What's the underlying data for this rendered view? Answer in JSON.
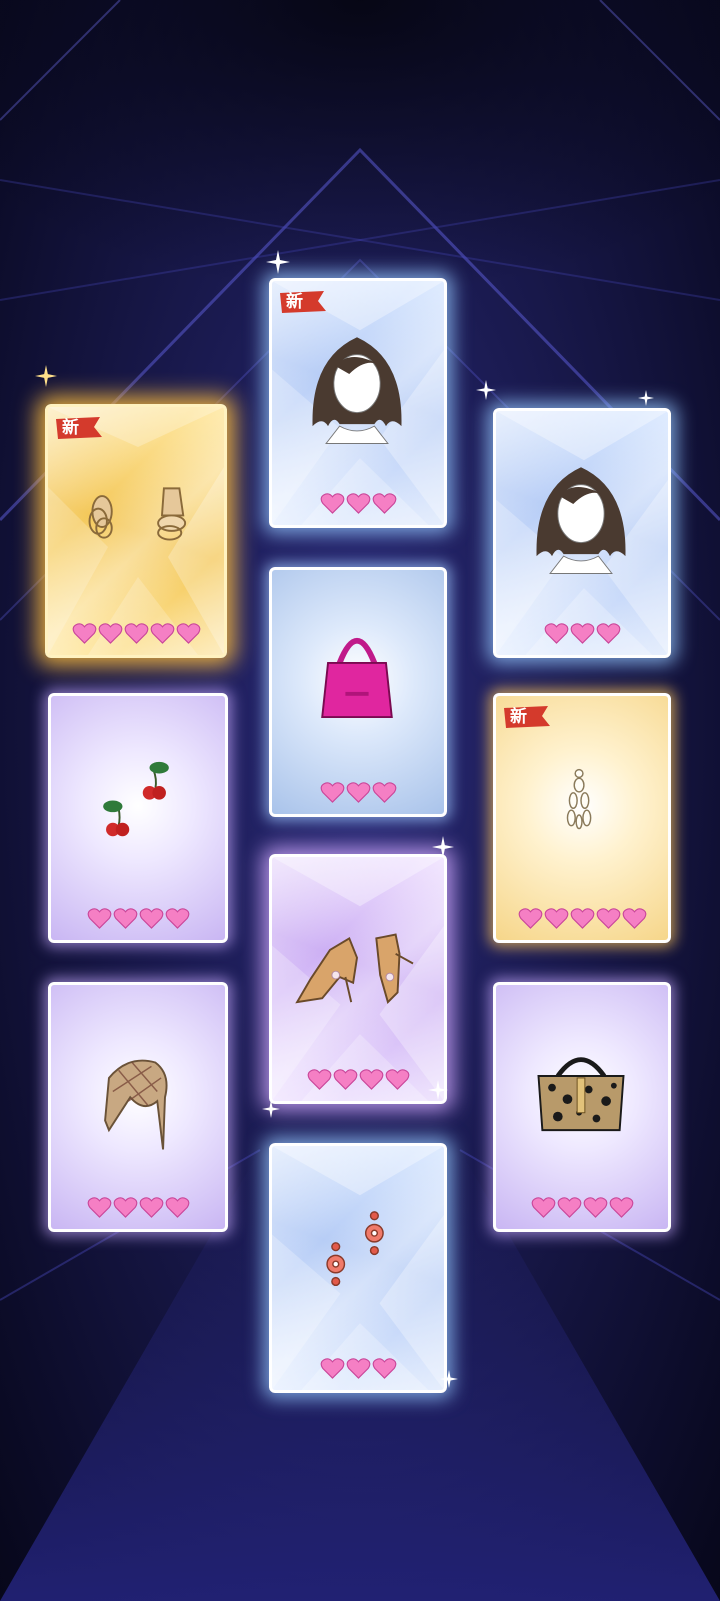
{
  "colors": {
    "background": "#141446",
    "heart": "#f57fc4",
    "heart_stroke": "#c9479a",
    "new_badge": "#d43a2c",
    "gold_glow": "#ffbe3c",
    "blue_glow": "#96c8ff",
    "purple_glow": "#d2aaff"
  },
  "new_badge_text": "新",
  "cards": [
    {
      "id": "earrings-gold-hoops",
      "rarity": "gold",
      "hearts": 5,
      "is_new": true,
      "icon": "hoop-earrings-icon"
    },
    {
      "id": "hair-bob-1",
      "rarity": "blue-diamond",
      "hearts": 3,
      "is_new": true,
      "icon": "bob-hair-icon"
    },
    {
      "id": "hair-bob-2",
      "rarity": "blue-diamond",
      "hearts": 3,
      "is_new": false,
      "icon": "bob-hair-icon"
    },
    {
      "id": "cherry-clips",
      "rarity": "purple",
      "hearts": 4,
      "is_new": false,
      "icon": "cherry-icon"
    },
    {
      "id": "pink-mini-bag",
      "rarity": "light-blue",
      "hearts": 3,
      "is_new": false,
      "icon": "handbag-icon"
    },
    {
      "id": "pearl-drop-earrings",
      "rarity": "gold-soft",
      "hearts": 5,
      "is_new": true,
      "icon": "drop-earring-icon"
    },
    {
      "id": "plaid-scarf",
      "rarity": "purple",
      "hearts": 4,
      "is_new": false,
      "icon": "scarf-icon"
    },
    {
      "id": "lace-up-heels",
      "rarity": "purple-diamond",
      "hearts": 4,
      "is_new": false,
      "icon": "heels-icon"
    },
    {
      "id": "leopard-tote",
      "rarity": "purple",
      "hearts": 4,
      "is_new": false,
      "icon": "tote-bag-icon"
    },
    {
      "id": "coral-earrings",
      "rarity": "blue-diamond",
      "hearts": 3,
      "is_new": false,
      "icon": "coral-earring-icon"
    }
  ]
}
